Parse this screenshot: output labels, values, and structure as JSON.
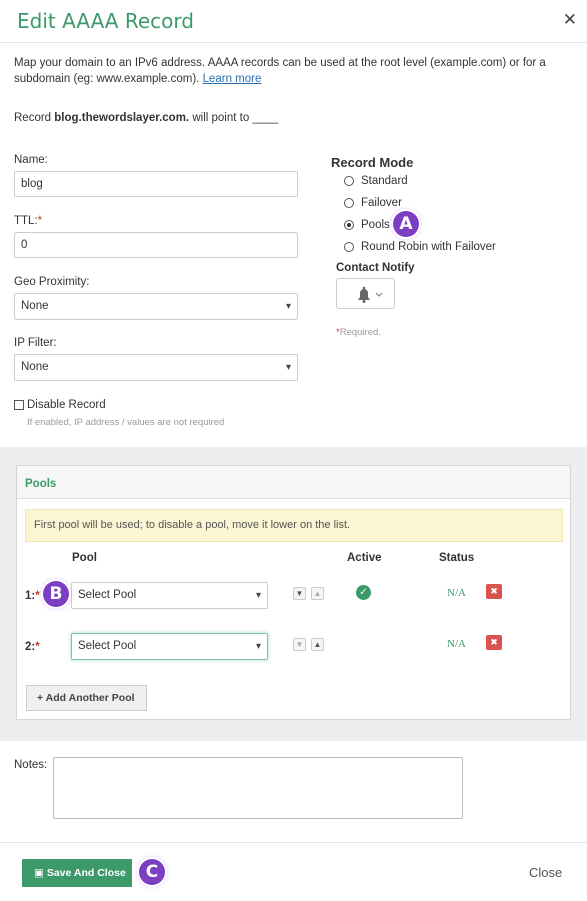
{
  "dialog": {
    "title": "Edit AAAA Record",
    "close_icon": "close-icon",
    "description": "Map your domain to an IPv6 address. AAAA records can be used at the root level (example.com) or for a subdomain (eg: www.example.com).",
    "learn_more": "Learn more",
    "record_prefix": "Record",
    "record_host": "blog.thewordslayer.com.",
    "record_suffix": "will point to ____"
  },
  "form": {
    "name_label": "Name:",
    "name_value": "blog",
    "ttl_label": "TTL:",
    "ttl_value": "0",
    "geo_label": "Geo Proximity:",
    "geo_value": "None",
    "ip_filter_label": "IP Filter:",
    "ip_filter_value": "None",
    "disable_label": "Disable Record",
    "disable_hint": "If enabled, IP address / values are not required",
    "required_star": "*"
  },
  "record_mode": {
    "title": "Record Mode",
    "options": [
      {
        "label": "Standard",
        "selected": false
      },
      {
        "label": "Failover",
        "selected": false
      },
      {
        "label": "Pools",
        "selected": true
      },
      {
        "label": "Round Robin with Failover",
        "selected": false
      }
    ],
    "contact_notify_title": "Contact Notify",
    "bell_icon": "bell-icon",
    "required_note": "Required."
  },
  "annotations": {
    "a": "A",
    "b": "B",
    "c": "C",
    "color": "#7d3fc2"
  },
  "pools": {
    "title": "Pools",
    "notice": "First pool will be used; to disable a pool, move it lower on the list.",
    "col_pool": "Pool",
    "col_active": "Active",
    "col_status": "Status",
    "rows": [
      {
        "label": "1:",
        "select": "Select Pool",
        "active": true,
        "status": "N/A"
      },
      {
        "label": "2:",
        "select": "Select Pool",
        "active": false,
        "status": "N/A"
      }
    ],
    "add_button": "Add Another Pool"
  },
  "notes": {
    "label": "Notes:",
    "value": ""
  },
  "footer": {
    "save": "Save And Close",
    "close": "Close"
  },
  "colors": {
    "accent": "#3c9a6a",
    "danger": "#d9534f",
    "notice_bg": "#fbf5d3"
  }
}
